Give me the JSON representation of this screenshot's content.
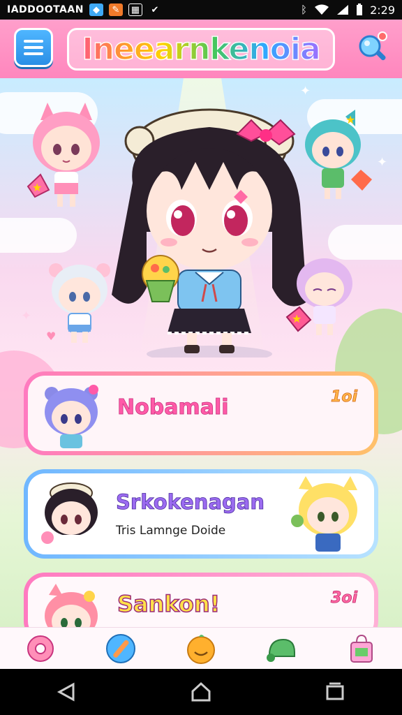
{
  "status_bar": {
    "carrier": "IADDOOTAAN",
    "time": "2:29",
    "icons": [
      "shield-icon",
      "app-icon",
      "news-icon",
      "check-icon",
      "bluetooth-icon",
      "wifi-icon",
      "signal-icon",
      "battery-icon"
    ]
  },
  "header": {
    "title": "Ineearnkenoia",
    "menu_icon": "menu-icon",
    "search_icon": "search-icon"
  },
  "cards": [
    {
      "name": "Nobamali",
      "subtitle": "",
      "count": "1oi",
      "accent": "#ff5aa8"
    },
    {
      "name": "Srkokenagan",
      "subtitle": "Tris Lamnge Doide",
      "count": "",
      "accent": "#9b6bf0"
    },
    {
      "name": "Sankon!",
      "subtitle": "",
      "count": "3oi",
      "accent": "#ffe14a"
    }
  ],
  "bottom_nav": [
    {
      "icon": "donut-icon",
      "label": ""
    },
    {
      "icon": "wand-icon",
      "label": ""
    },
    {
      "icon": "smiley-icon",
      "label": ""
    },
    {
      "icon": "cap-icon",
      "label": ""
    },
    {
      "icon": "shop-bag-icon",
      "label": ""
    }
  ],
  "system_nav": [
    "back-icon",
    "home-icon",
    "recents-icon"
  ],
  "colors": {
    "header_pink": "#ff8cc3",
    "menu_blue": "#2a8fe6",
    "scene_sky": "#c8ecff",
    "scene_grass": "#d9f1c8"
  }
}
